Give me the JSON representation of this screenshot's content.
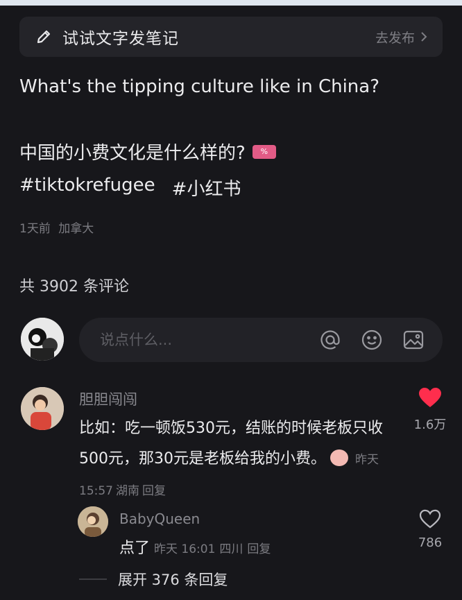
{
  "draft": {
    "title": "试试文字发笔记",
    "publish": "去发布"
  },
  "post": {
    "question_en": "What's the tipping culture like in China?",
    "question_zh": "中国的小费文化是什么样的?",
    "tags": [
      "#tiktokrefugee",
      "#小红书"
    ],
    "time": "1天前",
    "location": "加拿大"
  },
  "comments_count": "共 3902 条评论",
  "comment_input": {
    "placeholder": "说点什么..."
  },
  "comment": {
    "author": "胆胆闯闯",
    "text": "比如：吃一顿饭530元，结账的时候老板只收500元，那30元是老板给我的小费。",
    "time": "昨天 15:57",
    "location": "湖南",
    "reply": "回复",
    "likes": "1.6万",
    "liked": true
  },
  "reply": {
    "author": "BabyQueen",
    "text": "点了",
    "time": "昨天 16:01",
    "location": "四川",
    "reply": "回复",
    "likes": "786"
  },
  "expand": "展开 376 条回复",
  "colors": {
    "background": "#17171b",
    "like_red": "#ff2e4d"
  }
}
